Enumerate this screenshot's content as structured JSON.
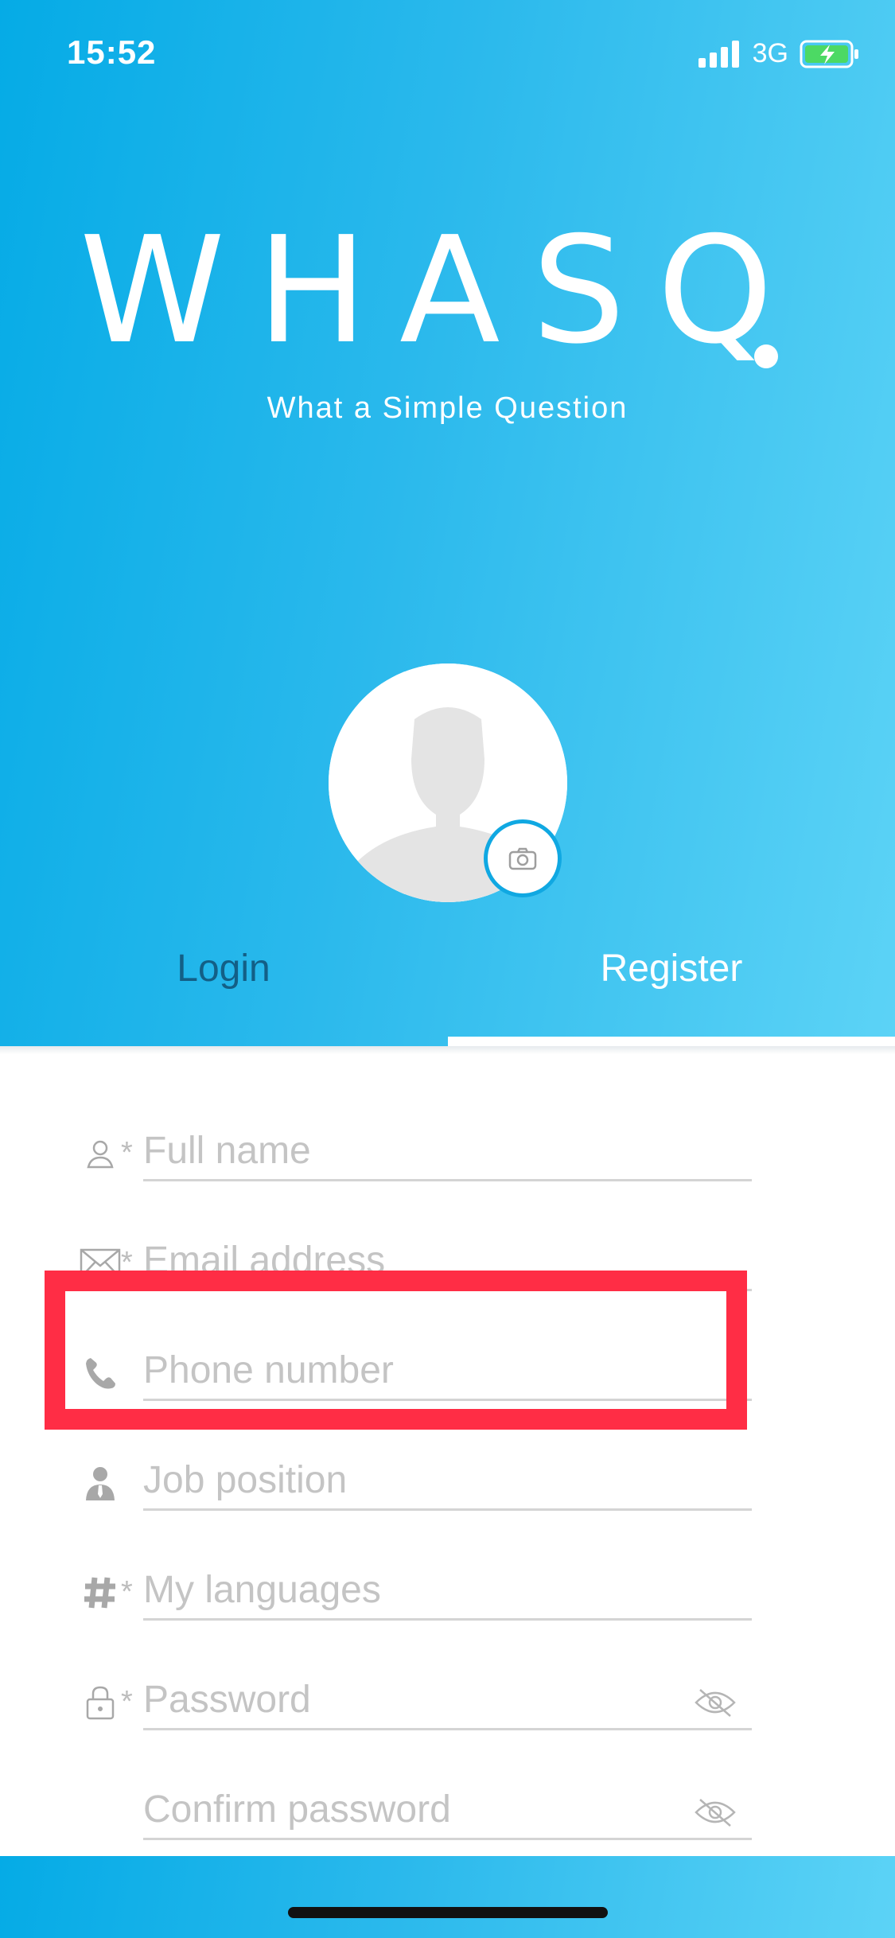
{
  "status_bar": {
    "time": "15:52",
    "network": "3G"
  },
  "brand": {
    "logo": "WHASQ",
    "tagline": "What a Simple Question"
  },
  "tabs": [
    {
      "label": "Login",
      "active": false
    },
    {
      "label": "Register",
      "active": true
    }
  ],
  "form": {
    "full_name": {
      "placeholder": "Full name",
      "required_mark": "*"
    },
    "email": {
      "placeholder": "Email address",
      "required_mark": "*"
    },
    "phone": {
      "placeholder": "Phone number"
    },
    "job": {
      "placeholder": "Job position"
    },
    "languages": {
      "placeholder": "My languages",
      "required_mark": "*"
    },
    "password": {
      "placeholder": "Password",
      "required_mark": "*"
    },
    "confirm_password": {
      "placeholder": "Confirm password"
    }
  },
  "colors": {
    "gradient_start": "#05abe6",
    "gradient_end": "#5cd3f6",
    "highlight": "#ff2d45",
    "tab_inactive": "#135f86"
  },
  "icons": [
    "signal-icon",
    "battery-charging-icon",
    "camera-icon",
    "user-icon",
    "mail-icon",
    "phone-icon",
    "person-tie-icon",
    "hash-icon",
    "lock-icon",
    "eye-off-icon"
  ]
}
